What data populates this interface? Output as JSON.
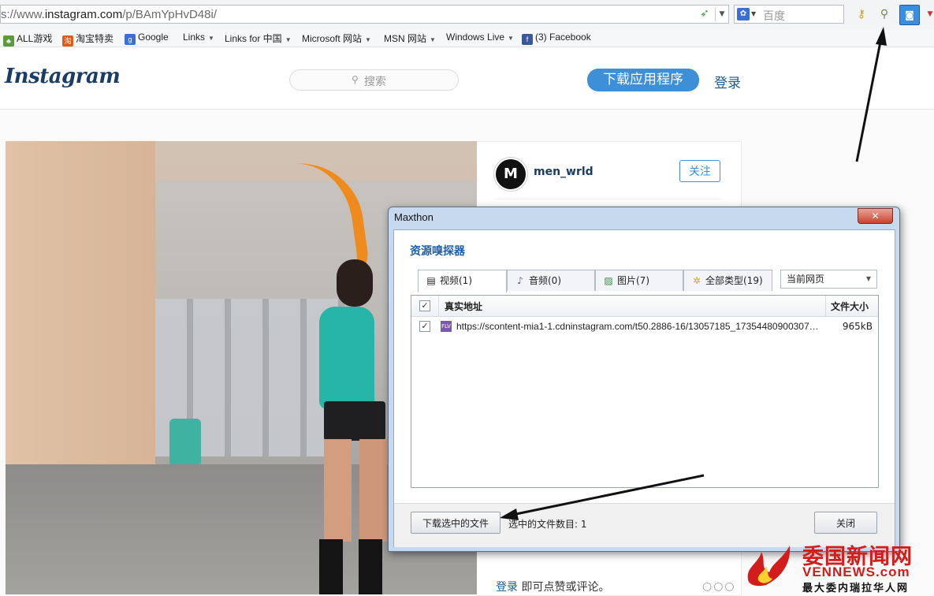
{
  "browser": {
    "url_prefix": "s://www.",
    "url_domain": "instagram.com",
    "url_path": "/p/BAmYpHvD48i/",
    "search_placeholder": "百度",
    "search_engine_icon": "paw",
    "icons": [
      "go-icon",
      "key-icon",
      "resource-sniffer-icon",
      "maxthon-icon",
      "menu-dropdown-icon"
    ]
  },
  "favorites": [
    {
      "label": "ALL游戏",
      "icon": "game",
      "color": "#5a9a3a",
      "caret": false
    },
    {
      "label": "淘宝特卖",
      "icon": "taobao",
      "color": "#e05a1a",
      "caret": false
    },
    {
      "label": "Google",
      "icon": "google",
      "color": "#3b6fd8",
      "caret": false
    },
    {
      "label": "Links",
      "icon": "",
      "color": "",
      "caret": true
    },
    {
      "label": "Links for 中国",
      "icon": "",
      "color": "",
      "caret": true
    },
    {
      "label": "Microsoft 网站",
      "icon": "",
      "color": "",
      "caret": true
    },
    {
      "label": "MSN 网站",
      "icon": "",
      "color": "",
      "caret": true
    },
    {
      "label": "Windows Live",
      "icon": "",
      "color": "",
      "caret": true
    },
    {
      "label": "(3) Facebook",
      "icon": "facebook",
      "color": "#3b5998",
      "caret": false
    }
  ],
  "instagram": {
    "logo": "Instagram",
    "search_placeholder": "搜索",
    "download_app": "下载应用程序",
    "login": "登录",
    "username": "men_wrld",
    "follow": "关注",
    "login_hint_link": "登录",
    "login_hint_rest": " 即可点赞或评论。",
    "more": "○○○",
    "accent": "#3d8fd8"
  },
  "dialog": {
    "title": "Maxthon",
    "close_glyph": "✕",
    "heading": "资源嗅探器",
    "tabs": [
      {
        "label": "视频(1)",
        "icon": "film-icon",
        "active": true
      },
      {
        "label": "音频(0)",
        "icon": "music-note-icon",
        "active": false
      },
      {
        "label": "图片(7)",
        "icon": "image-icon",
        "active": false
      },
      {
        "label": "全部类型(19)",
        "icon": "asterisk-icon",
        "active": false
      }
    ],
    "scope": "当前网页",
    "columns": {
      "url": "真实地址",
      "size": "文件大小"
    },
    "rows": [
      {
        "checked": true,
        "url": "https://scontent-mia1-1.cdninstagram.com/t50.2886-16/13057185_1735448090030705...",
        "size": "965kB"
      }
    ],
    "download_selected": "下载选中的文件",
    "selected_count": "选中的文件数目: 1",
    "close": "关闭"
  },
  "watermark": {
    "cn": "委国新闻网",
    "en": "VENNEWS.com",
    "sub": "最大委内瑞拉华人网"
  }
}
